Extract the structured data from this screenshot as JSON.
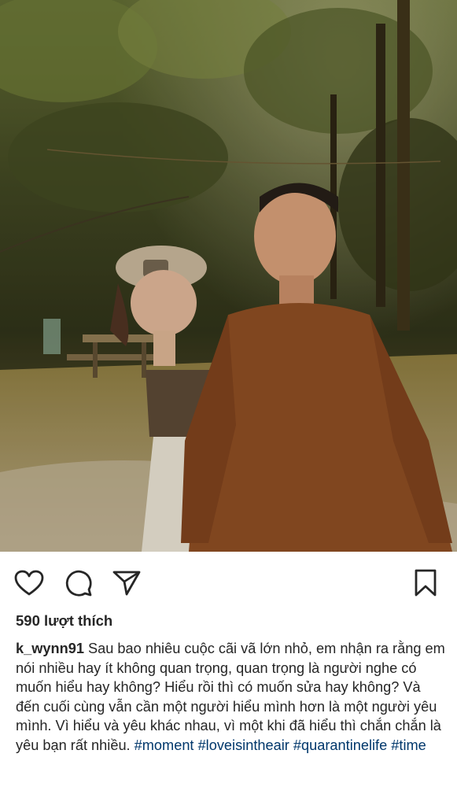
{
  "post": {
    "photo": {
      "icon": "photo-of-couple-walking-outdoors"
    },
    "actions": {
      "like_icon": "heart-icon",
      "comment_icon": "comment-bubble-icon",
      "share_icon": "paper-plane-icon",
      "save_icon": "bookmark-icon"
    },
    "likes_text": "590 lượt thích",
    "caption": {
      "username": "k_wynn91",
      "text": "Sau bao nhiêu cuộc cãi vã lớn nhỏ, em nhận ra rằng em nói nhiều hay ít không quan trọng, quan trọng là người nghe có muốn hiểu hay không? Hiểu rồi thì có muốn sửa hay không? Và đến cuối cùng vẫn cần một người hiểu mình hơn là một người yêu mình. Vì hiểu và yêu khác nhau, vì một khi đã hiểu thì chắn chắn là yêu bạn rất nhiều.",
      "hashtags": [
        "#moment",
        "#loveisintheair",
        "#quarantinelife",
        "#time"
      ]
    }
  },
  "colors": {
    "text": "#262626",
    "hashtag": "#00376b"
  }
}
